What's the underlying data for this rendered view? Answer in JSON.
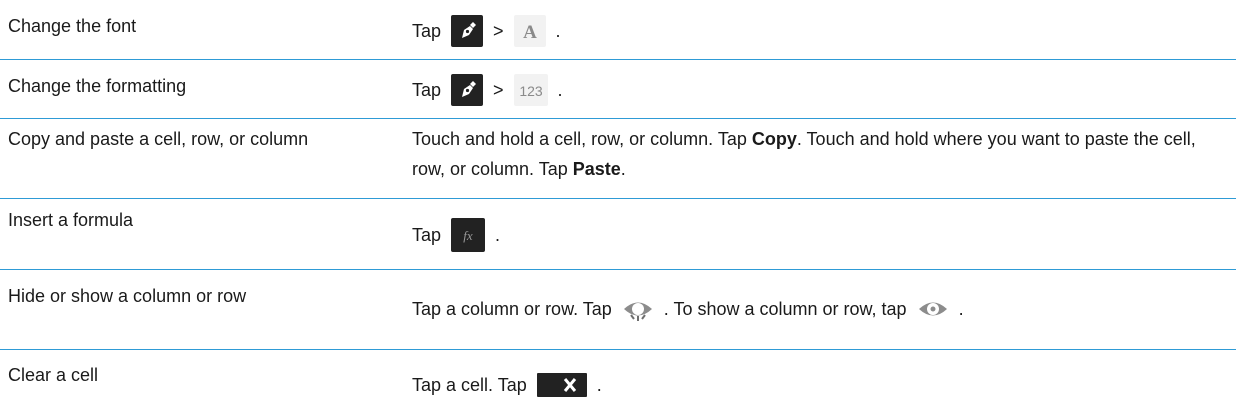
{
  "rows": [
    {
      "task": "Change the font",
      "tap": "Tap",
      "sep": ">",
      "end": "."
    },
    {
      "task": "Change the formatting",
      "tap": "Tap",
      "sep": ">",
      "icon2_text": "123",
      "end": "."
    },
    {
      "task": "Copy and paste a cell, row, or column",
      "part1": "Touch and hold a cell, row, or column. Tap ",
      "bold1": "Copy",
      "part2": ". Touch and hold where you want to paste the cell, row, or column. Tap ",
      "bold2": "Paste",
      "part3": "."
    },
    {
      "task": "Insert a formula",
      "tap": "Tap",
      "end": "."
    },
    {
      "task": "Hide or show a column or row",
      "part1": "Tap a column or row. Tap",
      "part2": ". To show a column or row, tap",
      "end": "."
    },
    {
      "task": "Clear a cell",
      "part1": "Tap a cell. Tap",
      "end": "."
    }
  ],
  "icons": {
    "edit": "pen-edit-icon",
    "font": "font-letter-icon",
    "number_format": "number-format-icon",
    "formula": "formula-fx-icon",
    "hide": "hide-column-icon",
    "show": "show-column-icon",
    "clear": "clear-x-icon"
  },
  "colors": {
    "divider": "#2e9bd6",
    "icon_dark": "#222222",
    "icon_light": "#f2f2f2"
  }
}
